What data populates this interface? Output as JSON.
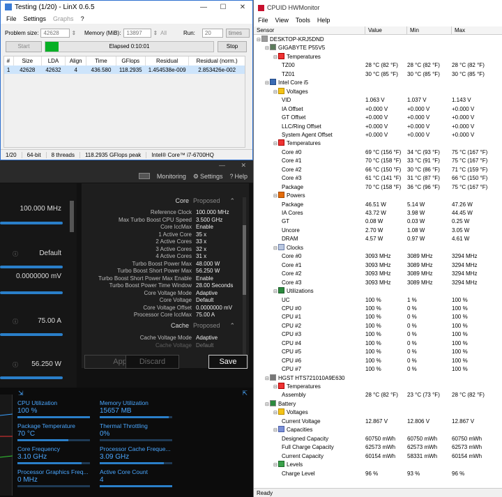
{
  "linx": {
    "title": "Testing (1/20) - LinX 0.6.5",
    "menu": [
      "File",
      "Settings",
      "Graphs",
      "?"
    ],
    "problem_size_label": "Problem size:",
    "problem_size": "42628",
    "memory_label": "Memory (MiB):",
    "memory": "13897",
    "all_label": "All",
    "run_label": "Run:",
    "run": "20",
    "times": "times",
    "start": "Start",
    "elapsed": "Elapsed 0:10:01",
    "stop": "Stop",
    "progress": 0.08,
    "columns": [
      "#",
      "Size",
      "LDA",
      "Align",
      "Time",
      "GFlops",
      "Residual",
      "Residual (norm.)"
    ],
    "rows": [
      [
        "1",
        "42628",
        "42632",
        "4",
        "436.580",
        "118.2935",
        "1.454538e-009",
        "2.853426e-002"
      ]
    ],
    "status": [
      "1/20",
      "64-bit",
      "8 threads",
      "118.2935 GFlops peak",
      "Intel® Core™ i7-6700HQ"
    ]
  },
  "xtu": {
    "nav": [
      "Monitoring",
      "Settings",
      "Help"
    ],
    "left_values": [
      "100.000 MHz",
      "Default",
      "0.0000000 mV",
      "75.00 A",
      "56.250 W"
    ],
    "core_header": "Core",
    "cache_header": "Cache",
    "proposed": "Proposed",
    "props": [
      [
        "Reference Clock",
        "100.000 MHz"
      ],
      [
        "Max Turbo Boost CPU Speed",
        "3.500 GHz"
      ],
      [
        "Core IccMax",
        "Enable"
      ],
      [
        "1 Active Core",
        "35 x"
      ],
      [
        "2 Active Cores",
        "33 x"
      ],
      [
        "3 Active Cores",
        "32 x"
      ],
      [
        "4 Active Cores",
        "31 x"
      ],
      [
        "Turbo Boost Power Max",
        "48.000 W"
      ],
      [
        "Turbo Boost Short Power Max",
        "56.250 W"
      ],
      [
        "Turbo Boost Short Power Max Enable",
        "Enable"
      ],
      [
        "Turbo Boost Power Time Window",
        "28.00 Seconds"
      ],
      [
        "Core Voltage Mode",
        "Adaptive"
      ],
      [
        "Core Voltage",
        "Default"
      ],
      [
        "Core Voltage Offset",
        "0.0000000 mV"
      ],
      [
        "Processor Core IccMax",
        "75.00 A"
      ]
    ],
    "cache_props": [
      [
        "Cache Voltage Mode",
        "Adaptive"
      ],
      [
        "Cache Voltage",
        "Default"
      ]
    ],
    "apply": "Apply",
    "discard": "Discard",
    "save": "Save",
    "monitors": [
      {
        "label": "CPU Utilization",
        "value": "100 %",
        "fill": 1.0
      },
      {
        "label": "Memory Utilization",
        "value": "15657  MB",
        "fill": 0.95
      },
      {
        "label": "Package Temperature",
        "value": "70 °C",
        "fill": 0.7
      },
      {
        "label": "Thermal Throttling",
        "value": "0%",
        "fill": 0
      },
      {
        "label": "Core Frequency",
        "value": "3.10 GHz",
        "fill": 0.88
      },
      {
        "label": "Processor Cache Freque...",
        "value": "3.09 GHz",
        "fill": 0.88
      },
      {
        "label": "Processor Graphics Freq...",
        "value": "0 MHz",
        "fill": 0
      },
      {
        "label": "Active Core Count",
        "value": "4",
        "fill": 1.0
      }
    ]
  },
  "hwm": {
    "title": "CPUID HWMonitor",
    "menu": [
      "File",
      "View",
      "Tools",
      "Help"
    ],
    "columns": [
      "Sensor",
      "Value",
      "Min",
      "Max"
    ],
    "rows": [
      {
        "lv": 0,
        "ic": "pc",
        "n": "DESKTOP-KRJ5DND"
      },
      {
        "lv": 1,
        "ic": "mb",
        "n": "GIGABYTE P55V5"
      },
      {
        "lv": 2,
        "ic": "temp",
        "n": "Temperatures"
      },
      {
        "lv": 3,
        "n": "TZ00",
        "v": "28 °C  (82 °F)",
        "mn": "28 °C  (82 °F)",
        "mx": "28 °C  (82 °F)"
      },
      {
        "lv": 3,
        "n": "TZ01",
        "v": "30 °C  (85 °F)",
        "mn": "30 °C  (85 °F)",
        "mx": "30 °C  (85 °F)"
      },
      {
        "lv": 1,
        "ic": "cpu",
        "n": "Intel Core i5"
      },
      {
        "lv": 2,
        "ic": "volt",
        "n": "Voltages"
      },
      {
        "lv": 3,
        "n": "VID",
        "v": "1.063 V",
        "mn": "1.037 V",
        "mx": "1.143 V"
      },
      {
        "lv": 3,
        "n": "IA Offset",
        "v": "+0.000 V",
        "mn": "+0.000 V",
        "mx": "+0.000 V"
      },
      {
        "lv": 3,
        "n": "GT Offset",
        "v": "+0.000 V",
        "mn": "+0.000 V",
        "mx": "+0.000 V"
      },
      {
        "lv": 3,
        "n": "LLC/Ring Offset",
        "v": "+0.000 V",
        "mn": "+0.000 V",
        "mx": "+0.000 V"
      },
      {
        "lv": 3,
        "n": "System Agent Offset",
        "v": "+0.000 V",
        "mn": "+0.000 V",
        "mx": "+0.000 V"
      },
      {
        "lv": 2,
        "ic": "temp",
        "n": "Temperatures"
      },
      {
        "lv": 3,
        "n": "Core #0",
        "v": "69 °C  (156 °F)",
        "mn": "34 °C  (93 °F)",
        "mx": "75 °C  (167 °F)"
      },
      {
        "lv": 3,
        "n": "Core #1",
        "v": "70 °C  (158 °F)",
        "mn": "33 °C  (91 °F)",
        "mx": "75 °C  (167 °F)"
      },
      {
        "lv": 3,
        "n": "Core #2",
        "v": "66 °C  (150 °F)",
        "mn": "30 °C  (86 °F)",
        "mx": "71 °C  (159 °F)"
      },
      {
        "lv": 3,
        "n": "Core #3",
        "v": "61 °C  (141 °F)",
        "mn": "31 °C  (87 °F)",
        "mx": "66 °C  (150 °F)"
      },
      {
        "lv": 3,
        "n": "Package",
        "v": "70 °C  (158 °F)",
        "mn": "36 °C  (96 °F)",
        "mx": "75 °C  (167 °F)"
      },
      {
        "lv": 2,
        "ic": "pow",
        "n": "Powers"
      },
      {
        "lv": 3,
        "n": "Package",
        "v": "46.51 W",
        "mn": "5.14 W",
        "mx": "47.26 W"
      },
      {
        "lv": 3,
        "n": "IA Cores",
        "v": "43.72 W",
        "mn": "3.98 W",
        "mx": "44.45 W"
      },
      {
        "lv": 3,
        "n": "GT",
        "v": "0.08 W",
        "mn": "0.03 W",
        "mx": "0.25 W"
      },
      {
        "lv": 3,
        "n": "Uncore",
        "v": "2.70 W",
        "mn": "1.08 W",
        "mx": "3.05 W"
      },
      {
        "lv": 3,
        "n": "DRAM",
        "v": "4.57 W",
        "mn": "0.97 W",
        "mx": "4.61 W"
      },
      {
        "lv": 2,
        "ic": "clk",
        "n": "Clocks"
      },
      {
        "lv": 3,
        "n": "Core #0",
        "v": "3093 MHz",
        "mn": "3089 MHz",
        "mx": "3294 MHz"
      },
      {
        "lv": 3,
        "n": "Core #1",
        "v": "3093 MHz",
        "mn": "3089 MHz",
        "mx": "3294 MHz"
      },
      {
        "lv": 3,
        "n": "Core #2",
        "v": "3093 MHz",
        "mn": "3089 MHz",
        "mx": "3294 MHz"
      },
      {
        "lv": 3,
        "n": "Core #3",
        "v": "3093 MHz",
        "mn": "3089 MHz",
        "mx": "3294 MHz"
      },
      {
        "lv": 2,
        "ic": "util",
        "n": "Utilizations"
      },
      {
        "lv": 3,
        "n": "UC",
        "v": "100 %",
        "mn": "1 %",
        "mx": "100 %"
      },
      {
        "lv": 3,
        "n": "CPU #0",
        "v": "100 %",
        "mn": "0 %",
        "mx": "100 %"
      },
      {
        "lv": 3,
        "n": "CPU #1",
        "v": "100 %",
        "mn": "0 %",
        "mx": "100 %"
      },
      {
        "lv": 3,
        "n": "CPU #2",
        "v": "100 %",
        "mn": "0 %",
        "mx": "100 %"
      },
      {
        "lv": 3,
        "n": "CPU #3",
        "v": "100 %",
        "mn": "0 %",
        "mx": "100 %"
      },
      {
        "lv": 3,
        "n": "CPU #4",
        "v": "100 %",
        "mn": "0 %",
        "mx": "100 %"
      },
      {
        "lv": 3,
        "n": "CPU #5",
        "v": "100 %",
        "mn": "0 %",
        "mx": "100 %"
      },
      {
        "lv": 3,
        "n": "CPU #6",
        "v": "100 %",
        "mn": "0 %",
        "mx": "100 %"
      },
      {
        "lv": 3,
        "n": "CPU #7",
        "v": "100 %",
        "mn": "0 %",
        "mx": "100 %"
      },
      {
        "lv": 1,
        "ic": "hd",
        "n": "HGST HTS721010A9E630"
      },
      {
        "lv": 2,
        "ic": "temp",
        "n": "Temperatures"
      },
      {
        "lv": 3,
        "n": "Assembly",
        "v": "28 °C  (82 °F)",
        "mn": "23 °C  (73 °F)",
        "mx": "28 °C  (82 °F)"
      },
      {
        "lv": 1,
        "ic": "bat",
        "n": "Battery"
      },
      {
        "lv": 2,
        "ic": "volt",
        "n": "Voltages"
      },
      {
        "lv": 3,
        "n": "Current Voltage",
        "v": "12.867 V",
        "mn": "12.806 V",
        "mx": "12.867 V"
      },
      {
        "lv": 2,
        "ic": "cap",
        "n": "Capacities"
      },
      {
        "lv": 3,
        "n": "Designed Capacity",
        "v": "60750 mWh",
        "mn": "60750 mWh",
        "mx": "60750 mWh"
      },
      {
        "lv": 3,
        "n": "Full Charge Capacity",
        "v": "62573 mWh",
        "mn": "62573 mWh",
        "mx": "62573 mWh"
      },
      {
        "lv": 3,
        "n": "Current Capacity",
        "v": "60154 mWh",
        "mn": "58331 mWh",
        "mx": "60154 mWh"
      },
      {
        "lv": 2,
        "ic": "lvl",
        "n": "Levels"
      },
      {
        "lv": 3,
        "n": "Charge Level",
        "v": "96 %",
        "mn": "93 %",
        "mx": "96 %"
      }
    ],
    "status": "Ready"
  }
}
